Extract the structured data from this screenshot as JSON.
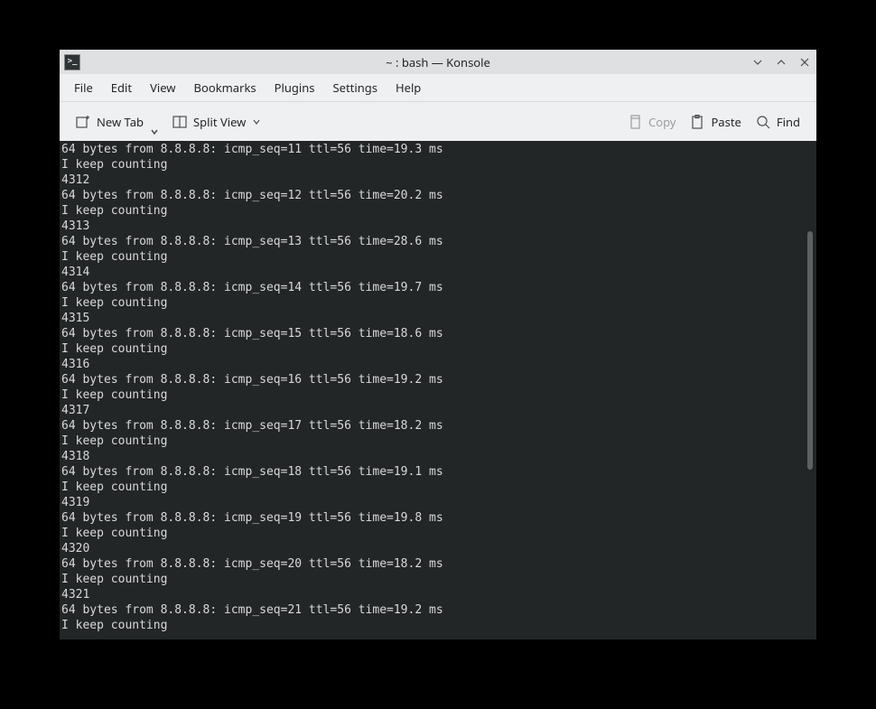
{
  "window": {
    "title": "~ : bash — Konsole"
  },
  "menubar": {
    "items": [
      "File",
      "Edit",
      "View",
      "Bookmarks",
      "Plugins",
      "Settings",
      "Help"
    ]
  },
  "toolbar": {
    "new_tab": "New Tab",
    "split_view": "Split View",
    "copy": "Copy",
    "paste": "Paste",
    "find": "Find"
  },
  "terminal": {
    "lines": [
      "64 bytes from 8.8.8.8: icmp_seq=11 ttl=56 time=19.3 ms",
      "I keep counting",
      "4312",
      "64 bytes from 8.8.8.8: icmp_seq=12 ttl=56 time=20.2 ms",
      "I keep counting",
      "4313",
      "64 bytes from 8.8.8.8: icmp_seq=13 ttl=56 time=28.6 ms",
      "I keep counting",
      "4314",
      "64 bytes from 8.8.8.8: icmp_seq=14 ttl=56 time=19.7 ms",
      "I keep counting",
      "4315",
      "64 bytes from 8.8.8.8: icmp_seq=15 ttl=56 time=18.6 ms",
      "I keep counting",
      "4316",
      "64 bytes from 8.8.8.8: icmp_seq=16 ttl=56 time=19.2 ms",
      "I keep counting",
      "4317",
      "64 bytes from 8.8.8.8: icmp_seq=17 ttl=56 time=18.2 ms",
      "I keep counting",
      "4318",
      "64 bytes from 8.8.8.8: icmp_seq=18 ttl=56 time=19.1 ms",
      "I keep counting",
      "4319",
      "64 bytes from 8.8.8.8: icmp_seq=19 ttl=56 time=19.8 ms",
      "I keep counting",
      "4320",
      "64 bytes from 8.8.8.8: icmp_seq=20 ttl=56 time=18.2 ms",
      "I keep counting",
      "4321",
      "64 bytes from 8.8.8.8: icmp_seq=21 ttl=56 time=19.2 ms",
      "I keep counting"
    ]
  }
}
